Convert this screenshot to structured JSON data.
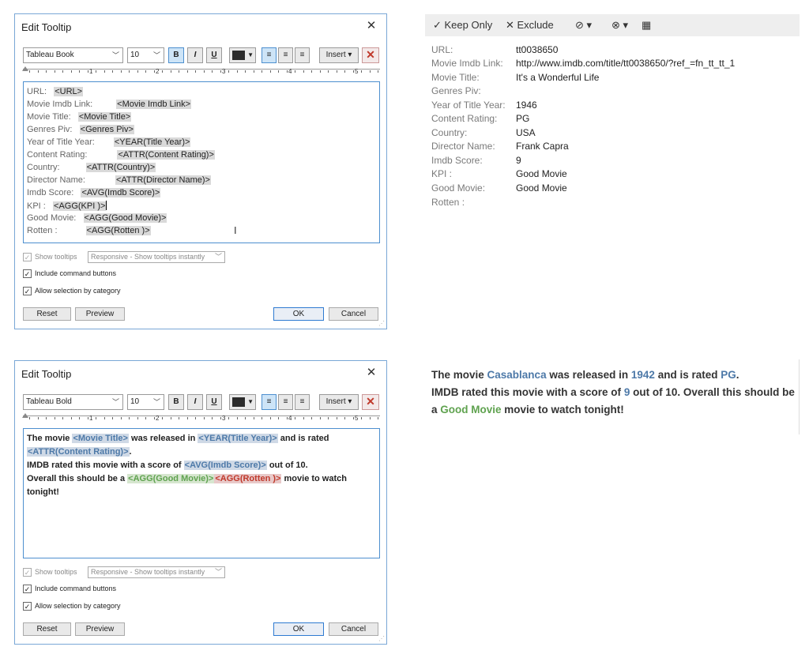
{
  "dialog_top": {
    "title": "Edit Tooltip",
    "close": "✕",
    "font_family": "Tableau Book",
    "font_size": "10",
    "bold": "B",
    "italic": "I",
    "underline": "U",
    "insert": "Insert ▾",
    "ruler_numbers": [
      "1",
      "2",
      "3",
      "4",
      "5"
    ],
    "lines": [
      {
        "label": "URL:",
        "field": "<URL>"
      },
      {
        "label": "Movie Imdb Link:",
        "field": "<Movie Imdb Link>"
      },
      {
        "label": "Movie Title:",
        "field": "<Movie Title>"
      },
      {
        "label": "Genres Piv:",
        "field": "<Genres Piv>"
      },
      {
        "label": "Year of Title Year:",
        "field": "<YEAR(Title Year)>"
      },
      {
        "label": "Content Rating:",
        "field": "<ATTR(Content Rating)>"
      },
      {
        "label": "Country:",
        "field": "<ATTR(Country)>"
      },
      {
        "label": "Director Name:",
        "field": "<ATTR(Director Name)>"
      },
      {
        "label": "Imdb Score:",
        "field": "<AVG(Imdb Score)>"
      },
      {
        "label": "KPI :",
        "field": "<AGG(KPI )>"
      },
      {
        "label": "Good Movie:",
        "field": "<AGG(Good Movie)>"
      },
      {
        "label": "Rotten :",
        "field": "<AGG(Rotten )>"
      }
    ],
    "show_tooltips": "Show tooltips",
    "tooltip_mode": "Responsive - Show tooltips instantly",
    "include_command_buttons": "Include command buttons",
    "allow_selection": "Allow selection by category",
    "reset": "Reset",
    "preview": "Preview",
    "ok": "OK",
    "cancel": "Cancel"
  },
  "dialog_bottom": {
    "title": "Edit Tooltip",
    "close": "✕",
    "font_family": "Tableau Bold",
    "font_size": "10",
    "bold": "B",
    "italic": "I",
    "underline": "U",
    "insert": "Insert ▾",
    "ruler_numbers": [
      "1",
      "2",
      "3",
      "4",
      "5"
    ],
    "text": {
      "p1": "The movie ",
      "f_title": "<Movie Title>",
      "p2": " was released in ",
      "f_year": "<YEAR(Title Year)>",
      "p3": " and is rated",
      "f_rating": "<ATTR(Content Rating)>",
      "p4": ".",
      "p5": "IMDB rated this movie with a score of ",
      "f_score": "<AVG(Imdb Score)>",
      "p6": " out of 10.",
      "p7": "Overall this should be a ",
      "f_good": "<AGG(Good Movie)>",
      "f_rotten": "<AGG(Rotten )>",
      "p8": " movie to watch",
      "p9": "tonight!"
    },
    "show_tooltips": "Show tooltips",
    "tooltip_mode": "Responsive - Show tooltips instantly",
    "include_command_buttons": "Include command buttons",
    "allow_selection": "Allow selection by category",
    "reset": "Reset",
    "preview": "Preview",
    "ok": "OK",
    "cancel": "Cancel"
  },
  "tooltip_toolbar": {
    "keep_only": "✓ Keep Only",
    "exclude": "✕ Exclude",
    "group_icon": "⊘ ▾",
    "set_icon": "⊗ ▾",
    "view_data_icon": "▦"
  },
  "tooltip_preview": [
    {
      "key": "URL:",
      "value": "tt0038650"
    },
    {
      "key": "Movie Imdb Link:",
      "value": "http://www.imdb.com/title/tt0038650/?ref_=fn_tt_tt_1"
    },
    {
      "key": "Movie Title:",
      "value": "It's a Wonderful Life"
    },
    {
      "key": "Genres Piv:",
      "value": ""
    },
    {
      "key": "Year of Title Year:",
      "value": "1946"
    },
    {
      "key": "Content Rating:",
      "value": "PG"
    },
    {
      "key": "Country:",
      "value": "USA"
    },
    {
      "key": "Director Name:",
      "value": "Frank Capra"
    },
    {
      "key": "Imdb Score:",
      "value": "9"
    },
    {
      "key": "KPI :",
      "value": "Good Movie"
    },
    {
      "key": "Good Movie:",
      "value": "Good Movie"
    },
    {
      "key": "Rotten :",
      "value": ""
    }
  ],
  "sentence_preview": {
    "s1": "The movie ",
    "title": "Casablanca",
    "s2": "  was released in ",
    "year": "1942",
    "s3": " and is rated ",
    "rating": "PG",
    "s4": ".",
    "s5": "IMDB rated this movie with a score of  ",
    "score": "9",
    "s6": " out of 10. Overall this should be a ",
    "good": "Good Movie",
    "s7": " movie to watch tonight!"
  },
  "colors": {
    "field_blue": "#4d79a8",
    "field_green": "#5fa24f",
    "field_red": "#c0392b",
    "dialog_border": "#7aa7d6"
  }
}
